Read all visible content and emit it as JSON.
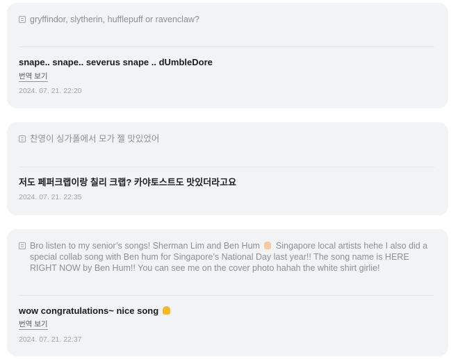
{
  "cards": [
    {
      "question": "gryffindor, slytherin, hufflepuff or ravenclaw?",
      "answer": "snape.. snape.. severus snape .. dUmbleDore",
      "translate_label": "번역 보기",
      "timestamp": "2024. 07. 21. 22:20"
    },
    {
      "question": "찬영이 싱가폴에서 모가 젤 맛있었어",
      "answer": "저도 페퍼크랩이랑 칠리 크랩? 카야토스트도 맛있더라고요",
      "timestamp": "2024. 07. 21. 22:35"
    },
    {
      "question_part1": "Bro listen to my senior’s songs! Sherman Lim and Ben Hum",
      "question_emoji": "hand-emoji",
      "question_part2": "Singapore local artists hehe I also did a special collab song with Ben hum for Singapore’s National Day last year!! The song name is HERE RIGHT NOW by Ben Hum!! You can see me on the cover photo hahah the white shirt girlie!",
      "answer": "wow congratulations~ nice song",
      "answer_emoji": "thumbs-up-emoji",
      "translate_label": "번역 보기",
      "timestamp": "2024. 07. 21. 22:37"
    }
  ],
  "icons": {
    "question": "question-icon"
  },
  "colors": {
    "card_bg": "#f2f3f5",
    "question_text": "#8a8f96",
    "answer_text": "#1a1b1e",
    "timestamp_text": "#9ea3aa"
  }
}
